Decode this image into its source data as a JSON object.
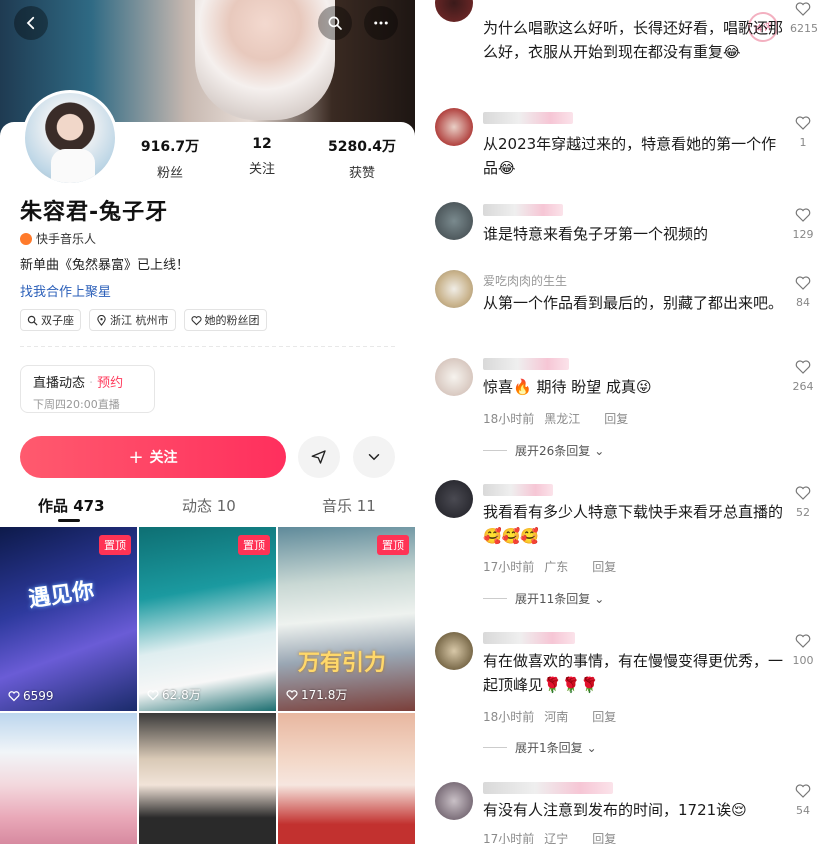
{
  "profile": {
    "stats": [
      {
        "num": "916.7万",
        "label": "粉丝"
      },
      {
        "num": "12",
        "label": "关注"
      },
      {
        "num": "5280.4万",
        "label": "获赞"
      }
    ],
    "name": "朱容君-兔子牙",
    "verify": "快手音乐人",
    "bio": "新单曲《兔然暴富》已上线！",
    "coop": "找我合作上聚星",
    "tags": [
      "双子座",
      "浙江 杭州市",
      "她的粉丝团"
    ]
  },
  "live": {
    "title": "直播动态",
    "reserve": "预约",
    "time": "下周四20:00直播"
  },
  "follow": {
    "label": "关注",
    "plus": "+"
  },
  "tabs": [
    "作品 473",
    "动态 10",
    "音乐 11"
  ],
  "videos": [
    {
      "pin": "置顶",
      "likes": "6599",
      "overlay": "遇见你"
    },
    {
      "pin": "置顶",
      "likes": "62.8万",
      "overlay": ""
    },
    {
      "pin": "置顶",
      "likes": "171.8万",
      "overlay": "万有引力"
    },
    {
      "pin": "",
      "likes": "",
      "overlay": ""
    },
    {
      "pin": "",
      "likes": "",
      "overlay": ""
    },
    {
      "pin": "",
      "likes": "",
      "overlay": ""
    }
  ],
  "comments": [
    {
      "name": "",
      "text": "为什么唱歌这么好听，长得还好看，唱歌还那么好，衣服从开始到现在都没有重复😂",
      "time": "",
      "loc": "",
      "reply": "",
      "expand": "",
      "likes": "6215"
    },
    {
      "name": "",
      "text": "从2023年穿越过来的，特意看她的第一个作品😂",
      "time": "",
      "loc": "",
      "reply": "",
      "expand": "",
      "likes": "1"
    },
    {
      "name": "",
      "text": "谁是特意来看兔子牙第一个视频的",
      "time": "",
      "loc": "",
      "reply": "",
      "expand": "",
      "likes": "129"
    },
    {
      "name": "爱吃肉肉的生生",
      "text": "从第一个作品看到最后的，别藏了都出来吧。",
      "time": "",
      "loc": "",
      "reply": "",
      "expand": "",
      "likes": "84"
    },
    {
      "name": "",
      "text": "惊喜🔥 期待 盼望 成真😜",
      "time": "18小时前",
      "loc": "黑龙江",
      "reply": "回复",
      "expand": "展开26条回复",
      "likes": "264"
    },
    {
      "name": "",
      "text": "我看看有多少人特意下载快手来看牙总直播的🥰🥰🥰",
      "time": "17小时前",
      "loc": "广东",
      "reply": "回复",
      "expand": "展开11条回复",
      "likes": "52"
    },
    {
      "name": "",
      "text": "有在做喜欢的事情，有在慢慢变得更优秀，一起顶峰见🌹🌹🌹",
      "time": "18小时前",
      "loc": "河南",
      "reply": "回复",
      "expand": "展开1条回复",
      "likes": "100"
    },
    {
      "name": "",
      "text": "有没有人注意到发布的时间，1721诶😌",
      "time": "17小时前",
      "loc": "辽宁",
      "reply": "回复",
      "expand": "",
      "likes": "54"
    }
  ],
  "stamp": "神评"
}
